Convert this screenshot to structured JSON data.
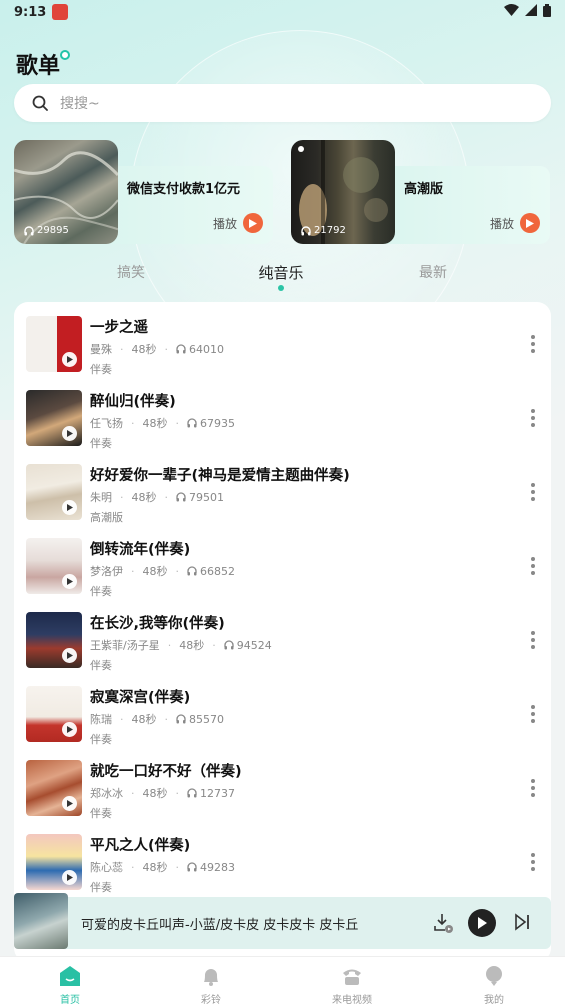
{
  "status_bar": {
    "time": "9:13"
  },
  "header": {
    "title": "歌单"
  },
  "search": {
    "placeholder": "搜搜~"
  },
  "featured": [
    {
      "name": "微信支付收款1亿元",
      "count": "29895",
      "play_label": "播放"
    },
    {
      "name": "高潮版",
      "count": "21792",
      "play_label": "播放"
    }
  ],
  "tabs": [
    {
      "label": "搞笑",
      "active": false
    },
    {
      "label": "纯音乐",
      "active": true
    },
    {
      "label": "最新",
      "active": false
    }
  ],
  "songs": [
    {
      "title": "一步之遥",
      "artist": "曼殊",
      "duration": "48秒",
      "plays": "64010",
      "tag": "伴奏"
    },
    {
      "title": "醉仙归(伴奏)",
      "artist": "任飞扬",
      "duration": "48秒",
      "plays": "67935",
      "tag": "伴奏"
    },
    {
      "title": "好好爱你一辈子(神马是爱情主题曲伴奏)",
      "artist": "朱明",
      "duration": "48秒",
      "plays": "79501",
      "tag": "高潮版"
    },
    {
      "title": "倒转流年(伴奏)",
      "artist": "梦洛伊",
      "duration": "48秒",
      "plays": "66852",
      "tag": "伴奏"
    },
    {
      "title": "在长沙,我等你(伴奏)",
      "artist": "王紫菲/汤子星",
      "duration": "48秒",
      "plays": "94524",
      "tag": "伴奏"
    },
    {
      "title": "寂寞深宫(伴奏)",
      "artist": "陈瑞",
      "duration": "48秒",
      "plays": "85570",
      "tag": "伴奏"
    },
    {
      "title": "就吃一口好不好（伴奏)",
      "artist": "郑冰冰",
      "duration": "48秒",
      "plays": "12737",
      "tag": "伴奏"
    },
    {
      "title": "平凡之人(伴奏)",
      "artist": "陈心蕊",
      "duration": "48秒",
      "plays": "49283",
      "tag": "伴奏"
    }
  ],
  "player": {
    "now_playing": "可爱的皮卡丘叫声-小蓝/皮卡皮 皮卡皮卡 皮卡丘"
  },
  "bottom_nav": [
    {
      "label": "首页",
      "icon": "home-icon",
      "active": true
    },
    {
      "label": "彩铃",
      "icon": "bell-icon",
      "active": false
    },
    {
      "label": "来电视频",
      "icon": "phone-icon",
      "active": false
    },
    {
      "label": "我的",
      "icon": "profile-icon",
      "active": false
    }
  ],
  "colors": {
    "accent": "#29c0a4",
    "play_orange": "#f0663c"
  }
}
